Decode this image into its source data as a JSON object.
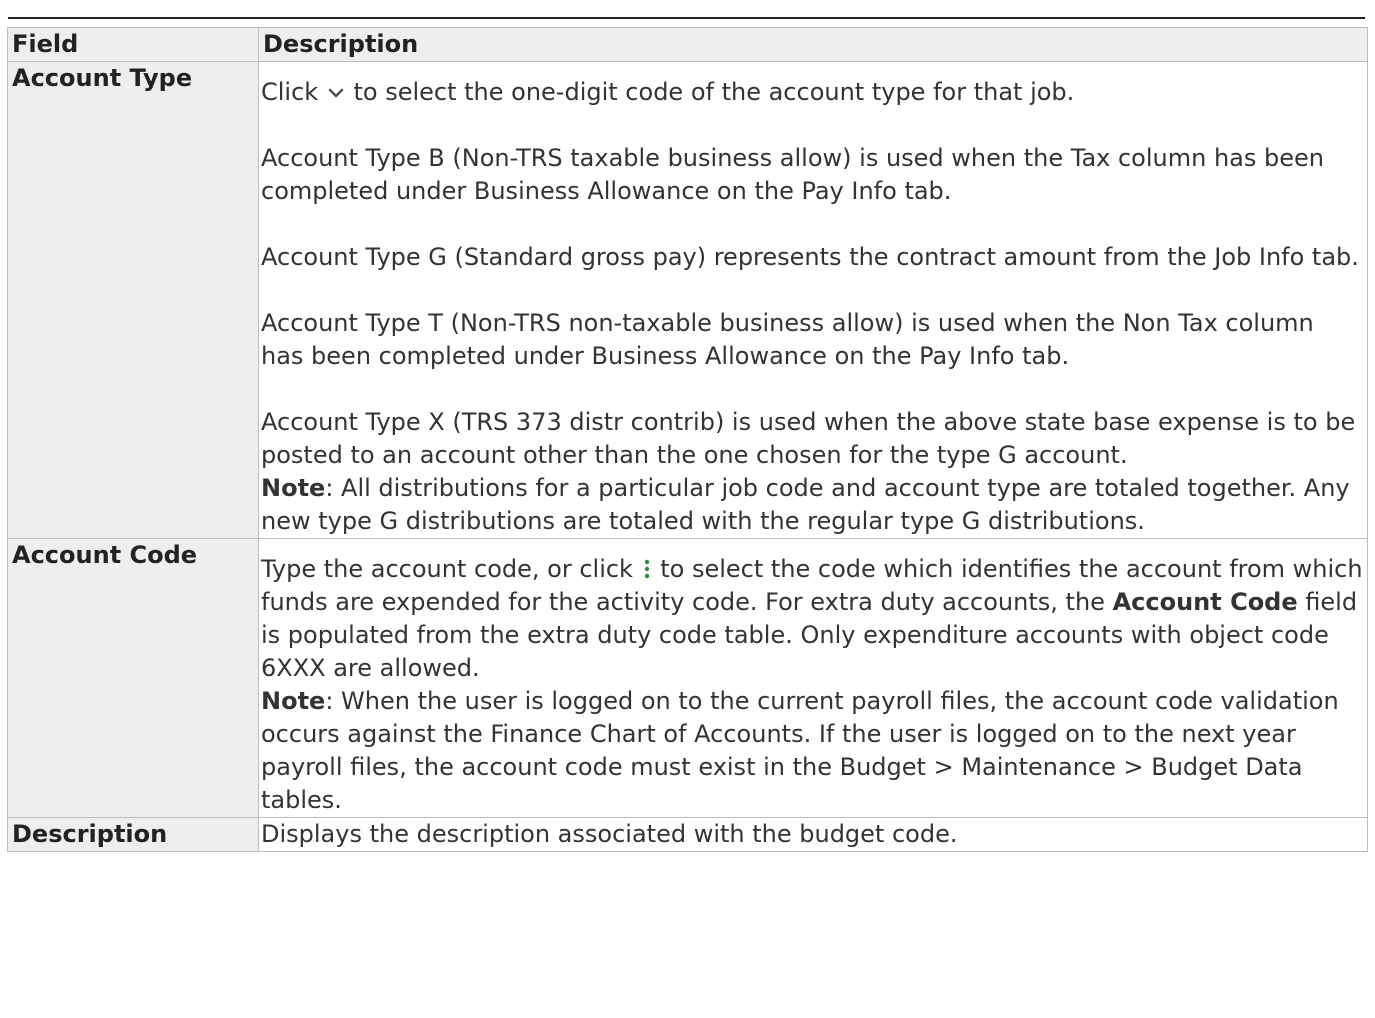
{
  "table": {
    "headers": {
      "field": "Field",
      "description": "Description"
    },
    "rows": {
      "account_type": {
        "field": "Account Type",
        "p1_pre": "Click",
        "p1_post": "to select the one-digit code of the account type for that job.",
        "p2": "Account Type B (Non-TRS taxable business allow) is used when the Tax column has been completed under Business Allowance on the Pay Info tab.",
        "p3": "Account Type G (Standard gross pay) represents the contract amount from the Job Info tab.",
        "p4": "Account Type T (Non-TRS non-taxable business allow) is used when the Non Tax column has been completed under Business Allowance on the Pay Info tab.",
        "p5": "Account Type X (TRS 373 distr contrib) is used when the above state base expense is to be posted to an account other than the one chosen for the type G account.",
        "note_label": "Note",
        "note_text": ": All distributions for a particular job code and account type are totaled together. Any new type G distributions are totaled with the regular type G distributions."
      },
      "account_code": {
        "field": "Account Code",
        "p1_pre": "Type the account code, or click",
        "p1_mid": "to select the code which identifies the account from which funds are expended for the activity code. For extra duty accounts, the",
        "p1_bold": "Account Code",
        "p1_post": "field is populated from the extra duty code table. Only expenditure accounts with object code 6XXX are allowed.",
        "note_label": "Note",
        "note_text": ": When the user is logged on to the current payroll files, the account code validation occurs against the Finance Chart of Accounts. If the user is logged on to the next year payroll files, the account code must exist in the Budget > Maintenance > Budget Data tables."
      },
      "description": {
        "field": "Description",
        "text": "Displays the description associated with the budget code."
      }
    }
  },
  "icons": {
    "dropdown": "chevron-down-icon",
    "lookup": "vertical-dots-icon",
    "lookup_color": "#2e8b3c"
  }
}
